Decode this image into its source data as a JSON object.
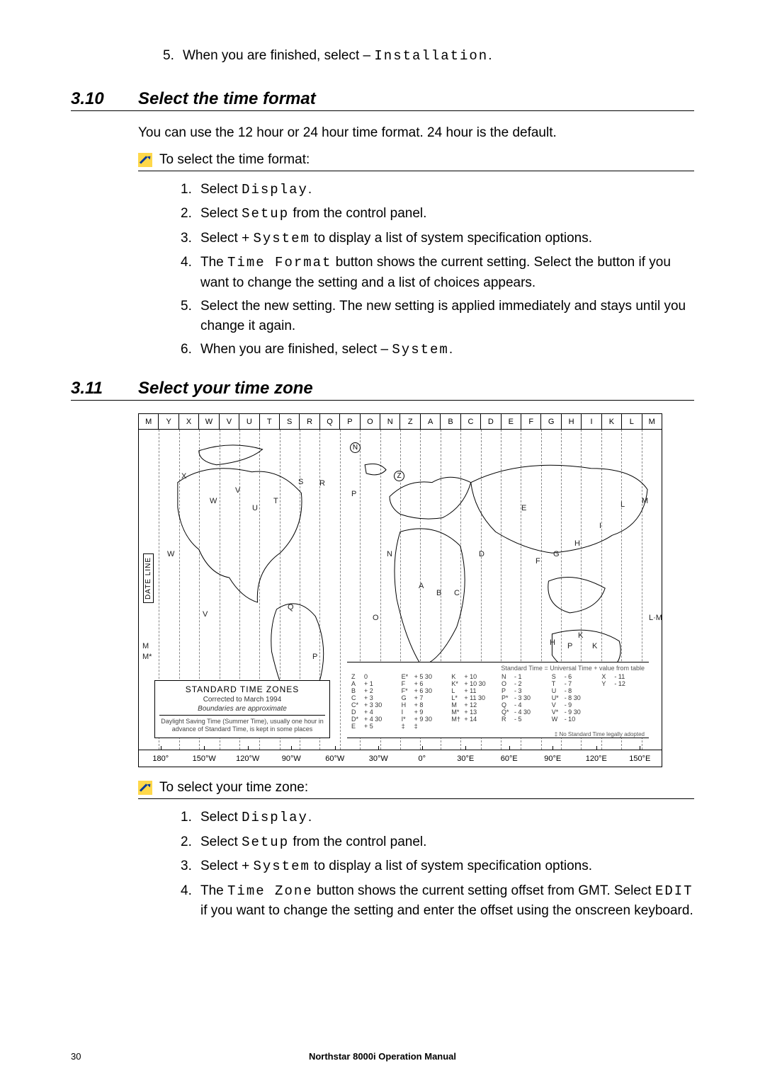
{
  "top_step": {
    "num": "5.",
    "pre": "When you are finished, select ",
    "dash": "– ",
    "cmd": "Installation",
    "after": "."
  },
  "s310": {
    "num": "3.10",
    "title": "Select the time format",
    "intro": "You can use the 12 hour or 24 hour time format. 24 hour is the default.",
    "sub": "To select the time format:",
    "steps": [
      {
        "n": "1.",
        "pre": "Select ",
        "cmd": "Display",
        "after": "."
      },
      {
        "n": "2.",
        "pre": "Select ",
        "cmd": "Setup",
        "after": " from the control panel."
      },
      {
        "n": "3.",
        "pre": "Select ",
        "plus": "+ ",
        "cmd": "System",
        "after": " to display a list of system specification options."
      },
      {
        "n": "4.",
        "pre": "The ",
        "cmd": "Time Format",
        "after": " button shows the current setting. Select the button if you want to change the setting and a list of choices appears."
      },
      {
        "n": "5.",
        "text": "Select the new setting. The new setting is applied immediately and stays until you change it again."
      },
      {
        "n": "6.",
        "pre": "When you are finished, select ",
        "dash": "– ",
        "cmd": "System",
        "after": "."
      }
    ]
  },
  "s311": {
    "num": "3.11",
    "title": "Select your time zone",
    "sub": "To select your time zone:",
    "steps": [
      {
        "n": "1.",
        "pre": "Select ",
        "cmd": "Display",
        "after": "."
      },
      {
        "n": "2.",
        "pre": "Select ",
        "cmd": "Setup",
        "after": " from the control panel."
      },
      {
        "n": "3.",
        "pre": "Select ",
        "plus": "+ ",
        "cmd": "System",
        "after": " to display a list of system specification options."
      },
      {
        "n": "4.",
        "pre": "The ",
        "cmd": "Time Zone",
        "after": " button shows the current setting offset from GMT. Select ",
        "cmd2": "EDIT",
        "after2": " if you want to change the setting and enter the offset using the onscreen keyboard."
      }
    ]
  },
  "figure": {
    "top_letters": [
      "M",
      "Y",
      "X",
      "W",
      "V",
      "U",
      "T",
      "S",
      "R",
      "Q",
      "P",
      "O",
      "N",
      "Z",
      "A",
      "B",
      "C",
      "D",
      "E",
      "F",
      "G",
      "H",
      "I",
      "K",
      "L",
      "M"
    ],
    "bottom_labels": [
      "180°",
      "150°W",
      "120°W",
      "90°W",
      "60°W",
      "30°W",
      "0°",
      "30°E",
      "60°E",
      "90°E",
      "120°E",
      "150°E"
    ],
    "legend": {
      "head": "STANDARD TIME ZONES",
      "l1": "Corrected to March 1994",
      "l2": "Boundaries are approximate",
      "l3": "Daylight Saving Time (Summer Time), usually one hour in advance of Standard Time, is kept in some places"
    },
    "tz_head": "Standard Time = Universal Time + value from table",
    "tz_note": "‡ No Standard Time legally adopted",
    "dateline": "DATE LINE",
    "tz_cols": [
      [
        [
          "Z",
          "0"
        ],
        [
          "A",
          "+ 1"
        ],
        [
          "B",
          "+ 2"
        ],
        [
          "C",
          "+ 3"
        ],
        [
          "C*",
          "+ 3 30"
        ],
        [
          "D",
          "+ 4"
        ],
        [
          "D*",
          "+ 4 30"
        ],
        [
          "E",
          "+ 5"
        ]
      ],
      [
        [
          "E*",
          "+ 5 30"
        ],
        [
          "F",
          "+ 6"
        ],
        [
          "F*",
          "+ 6 30"
        ],
        [
          "G",
          "+ 7"
        ],
        [
          "H",
          "+ 8"
        ],
        [
          "I",
          "+ 9"
        ],
        [
          "I*",
          "+ 9 30"
        ],
        [
          "‡",
          "‡"
        ]
      ],
      [
        [
          "K",
          "+ 10"
        ],
        [
          "K*",
          "+ 10 30"
        ],
        [
          "L",
          "+ 11"
        ],
        [
          "L*",
          "+ 11 30"
        ],
        [
          "M",
          "+ 12"
        ],
        [
          "M*",
          "+ 13"
        ],
        [
          "M†",
          "+ 14"
        ],
        [
          "",
          ""
        ]
      ],
      [
        [
          "N",
          "- 1"
        ],
        [
          "O",
          "- 2"
        ],
        [
          "P",
          "- 3"
        ],
        [
          "P*",
          "- 3 30"
        ],
        [
          "Q",
          "- 4"
        ],
        [
          "Q*",
          "- 4 30"
        ],
        [
          "R",
          "- 5"
        ],
        [
          "",
          ""
        ]
      ],
      [
        [
          "S",
          "- 6"
        ],
        [
          "T",
          "- 7"
        ],
        [
          "U",
          "- 8"
        ],
        [
          "U*",
          "- 8 30"
        ],
        [
          "V",
          "- 9"
        ],
        [
          "V*",
          "- 9 30"
        ],
        [
          "W",
          "- 10"
        ],
        [
          "",
          ""
        ]
      ],
      [
        [
          "X",
          "- 11"
        ],
        [
          "Y",
          "- 12"
        ],
        [
          "",
          ""
        ],
        [
          "",
          ""
        ],
        [
          "",
          ""
        ],
        [
          "",
          ""
        ],
        [
          "",
          ""
        ],
        [
          "",
          ""
        ]
      ]
    ]
  },
  "footer": {
    "page": "30",
    "title": "Northstar 8000i Operation Manual"
  }
}
